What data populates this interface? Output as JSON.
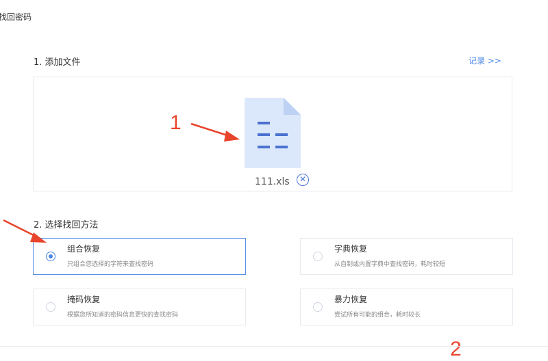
{
  "page": {
    "title": "找回密码"
  },
  "section1": {
    "label": "1. 添加文件",
    "history_link": "记录 >>"
  },
  "file": {
    "name": "111.xls",
    "remove_symbol": "✕",
    "icon": "spreadsheet-file-icon"
  },
  "section2": {
    "label": "2. 选择找回方法"
  },
  "methods": [
    {
      "title": "组合恢复",
      "desc": "只组合您选择的字符来查找密码",
      "selected": true
    },
    {
      "title": "字典恢复",
      "desc": "从自制或内置字典中查找密码，耗时较短",
      "selected": false
    },
    {
      "title": "掩码恢复",
      "desc": "根据您所知道的密码信息更快的查找密码",
      "selected": false
    },
    {
      "title": "暴力恢复",
      "desc": "尝试所有可能的组合，耗时较长",
      "selected": false
    }
  ],
  "annotations": {
    "step1": "1",
    "step2": "2"
  },
  "colors": {
    "accent": "#4a86e8",
    "annotation": "#e8452c",
    "file_icon": "#dbe7fb"
  }
}
